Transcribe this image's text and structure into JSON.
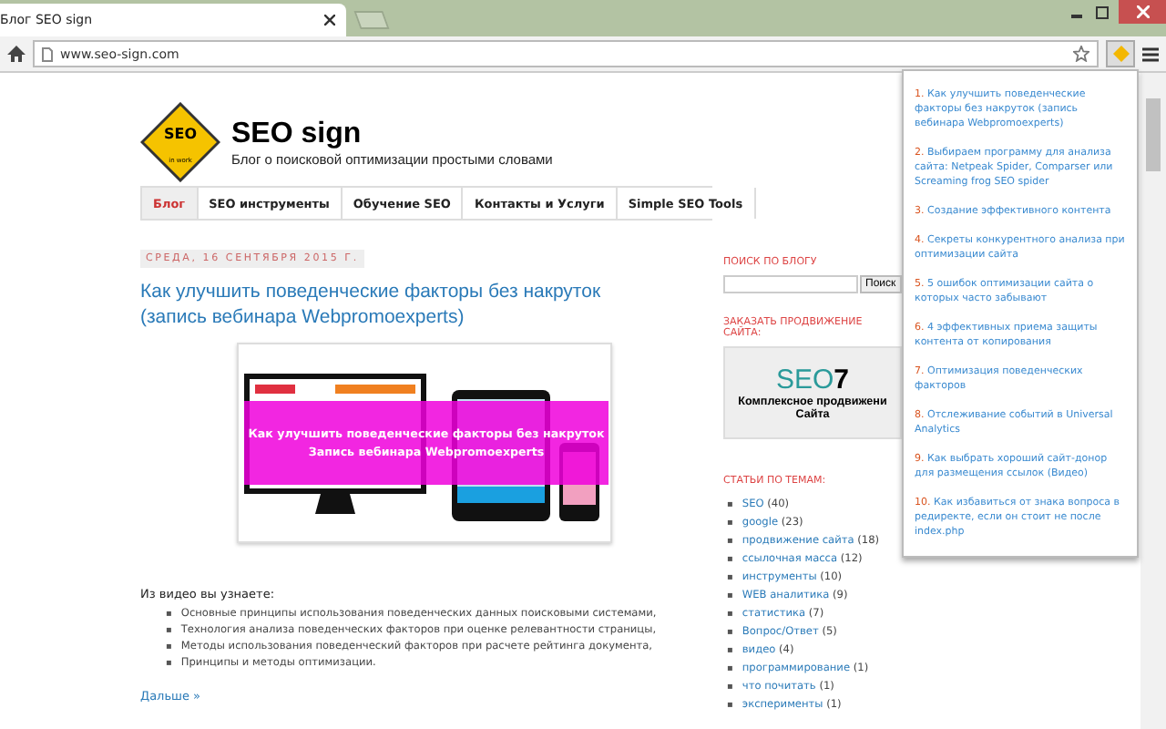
{
  "browser": {
    "tab_title": "Блог SEO sign",
    "url": "www.seo-sign.com"
  },
  "blog": {
    "logo_lines": [
      "SEO",
      "in work"
    ],
    "title": "SEO sign",
    "subtitle": "Блог о поисковой оптимизации простыми словами"
  },
  "nav": [
    {
      "label": "Блог",
      "selected": true
    },
    {
      "label": "SEO инструменты",
      "selected": false
    },
    {
      "label": "Обучение SEO",
      "selected": false
    },
    {
      "label": "Контакты и Услуги",
      "selected": false
    },
    {
      "label": "Simple SEO Tools",
      "selected": false
    }
  ],
  "post": {
    "date": "СРЕДА, 16 СЕНТЯБРЯ 2015 Г.",
    "title": "Как улучшить поведенческие факторы без накруток (запись вебинара Webpromoexperts)",
    "image_caption": [
      "Как улучшить поведенческие факторы без накруток",
      "Запись вебинара Webpromoexperts"
    ],
    "intro": "Из видео вы узнаете:",
    "bullet_marker": "▪",
    "bullets": [
      "Основные принципы использования поведенческих данных поисковыми системами,",
      "Технология анализа поведенческих факторов при оценке релевантности страницы,",
      "Методы использования поведенческий факторов при расчете рейтинга документа,",
      "Принципы и методы оптимизации."
    ],
    "more_link": "Дальше »"
  },
  "sidebar": {
    "search_heading": "ПОИСК ПО БЛОГУ",
    "search_button": "Поиск",
    "order_heading": "ЗАКАЗАТЬ ПРОДВИЖЕНИЕ САЙТА:",
    "banner_logo": "SEO",
    "banner_digit": "7",
    "banner_lines": [
      "Комплексное продвижени",
      "Сайта"
    ],
    "topics_heading": "СТАТЬИ ПО ТЕМАМ:",
    "bullet_marker": "▪",
    "topics": [
      {
        "label": "SEO",
        "count": "(40)"
      },
      {
        "label": "google",
        "count": "(23)"
      },
      {
        "label": "продвижение сайта",
        "count": "(18)"
      },
      {
        "label": "ссылочная масса",
        "count": "(12)"
      },
      {
        "label": "инструменты",
        "count": "(10)"
      },
      {
        "label": "WEB аналитика",
        "count": "(9)"
      },
      {
        "label": "статистика",
        "count": "(7)"
      },
      {
        "label": "Вопрос/Ответ",
        "count": "(5)"
      },
      {
        "label": "видео",
        "count": "(4)"
      },
      {
        "label": "программирование",
        "count": "(1)"
      },
      {
        "label": "что почитать",
        "count": "(1)"
      },
      {
        "label": "эксперименты",
        "count": "(1)"
      }
    ]
  },
  "popup": [
    {
      "number": "1.",
      "text": "Как улучшить поведенческие факторы без накруток (запись вебинара Webpromoexperts)"
    },
    {
      "number": "2.",
      "text": "Выбираем программу для анализа сайта: Netpeak Spider, Comparser или Screaming frog SEO spider"
    },
    {
      "number": "3.",
      "text": "Создание эффективного контента"
    },
    {
      "number": "4.",
      "text": "Секреты конкурентного анализа при оптимизации сайта"
    },
    {
      "number": "5.",
      "text": "5 ошибок оптимизации сайта о которых часто забывают"
    },
    {
      "number": "6.",
      "text": "4 эффективных приема защиты контента от копирования"
    },
    {
      "number": "7.",
      "text": "Оптимизация поведенческих факторов"
    },
    {
      "number": "8.",
      "text": "Отслеживание событий в Universal Analytics"
    },
    {
      "number": "9.",
      "text": "Как выбрать хороший сайт-донор для размещения ссылок (Видео)"
    },
    {
      "number": "10.",
      "text": "Как избавиться от знака вопроса в редиректе, если он стоит не после index.php"
    }
  ]
}
